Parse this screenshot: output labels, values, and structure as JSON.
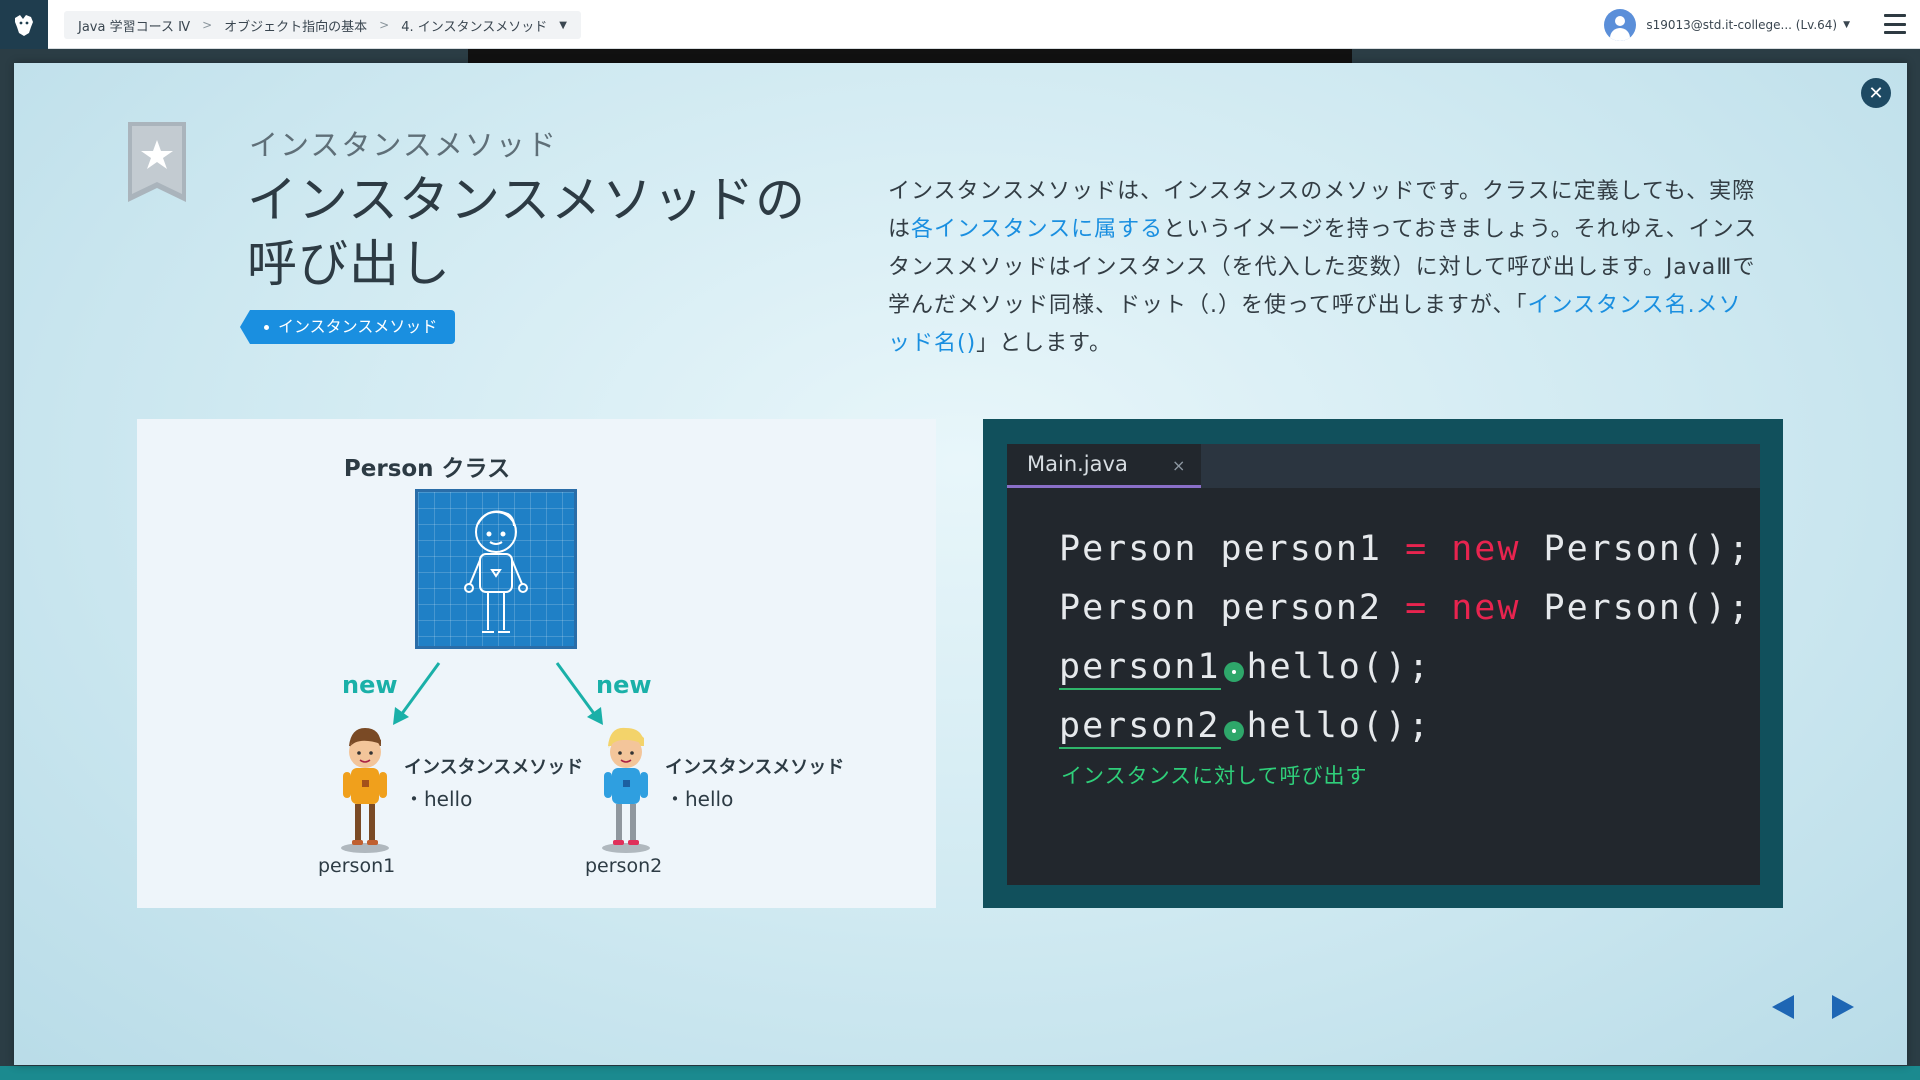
{
  "breadcrumb": {
    "course": "Java 学習コース Ⅳ",
    "chapter": "オブジェクト指向の基本",
    "lesson": "4. インスタンスメソッド"
  },
  "user": {
    "label": "s19013@std.it-college... (Lv.64)"
  },
  "slide": {
    "subtitle": "インスタンスメソッド",
    "title_line1": "インスタンスメソッドの",
    "title_line2": "呼び出し",
    "tag": "インスタンスメソッド",
    "desc_part1": "インスタンスメソッドは、インスタンスのメソッドです。クラスに定義しても、実際は",
    "desc_hl1": "各インスタンスに属する",
    "desc_part2": "というイメージを持っておきましょう。それゆえ、インスタンスメソッドはインスタンス（を代入した変数）に対して呼び出します。JavaⅢで学んだメソッド同様、ドット（.）を使って呼び出しますが、「",
    "desc_hl2": "インスタンス名.メソッド名()",
    "desc_part3": "」とします。"
  },
  "diagram": {
    "title": "Person クラス",
    "new_left": "new",
    "new_right": "new",
    "p1_caption": "インスタンスメソッド",
    "p1_method": "・hello",
    "p1_name": "person1",
    "p2_caption": "インスタンスメソッド",
    "p2_method": "・hello",
    "p2_name": "person2"
  },
  "code": {
    "tab": "Main.java",
    "tab_close": "×",
    "l1_a": "Person person1 ",
    "l1_eq": "=",
    "l1_new": " new",
    "l1_b": " Person();",
    "l2_a": "Person person2 ",
    "l2_eq": "=",
    "l2_new": " new",
    "l2_b": " Person();",
    "l3_var": "person1",
    "l3_rest": "hello();",
    "l4_var": "person2",
    "l4_rest": "hello();",
    "note": "インスタンスに対して呼び出す"
  },
  "colors": {
    "accent": "#1a8fe0",
    "keyword": "#e8244f",
    "code_note": "#2fcf7a",
    "teal_arrow": "#1ab0a8"
  },
  "icons": {
    "logo": "logo-icon",
    "close": "close-icon",
    "bookmark": "bookmark-star-icon",
    "menu": "hamburger-menu-icon",
    "prev": "prev-arrow-icon",
    "next": "next-arrow-icon"
  }
}
